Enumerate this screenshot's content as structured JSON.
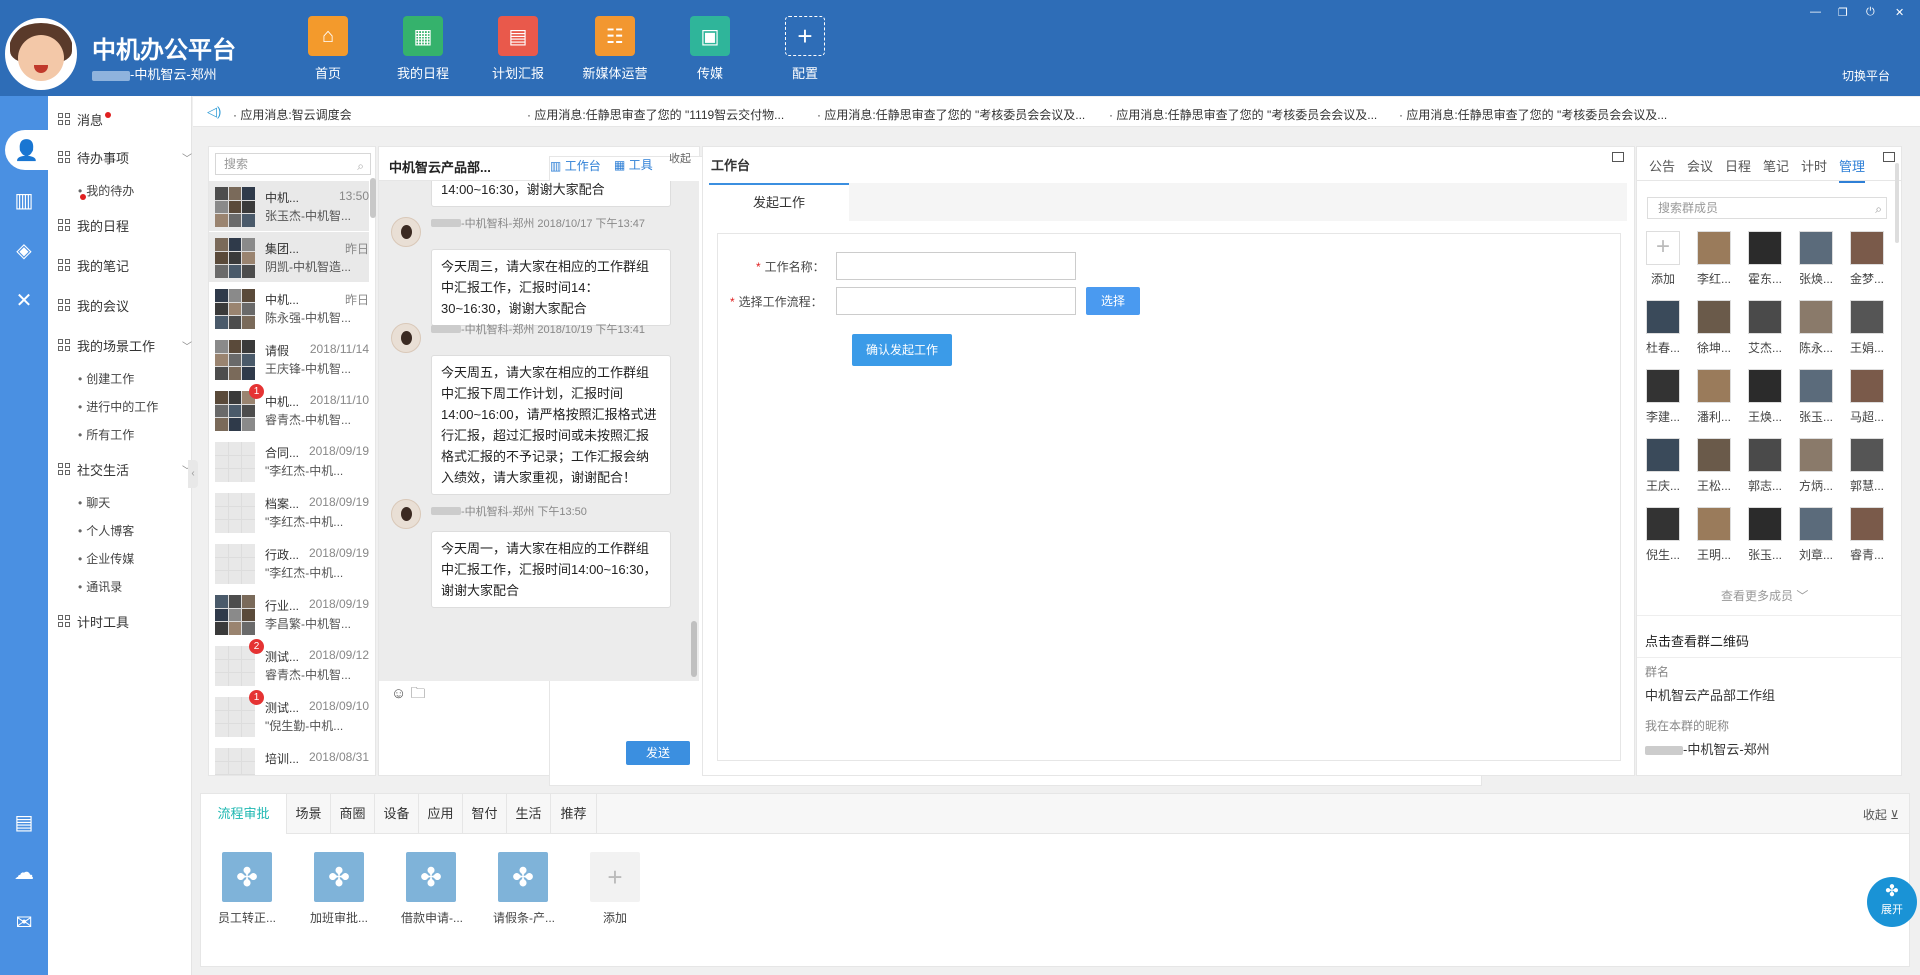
{
  "app": {
    "title": "中机办公平台",
    "subtitle": "-中机智云-郑州",
    "switch_label": "切换平台"
  },
  "nav": [
    {
      "label": "首页",
      "icon": "home-icon",
      "color": "#f39a2c"
    },
    {
      "label": "我的日程",
      "icon": "calendar-icon",
      "color": "#35b26c"
    },
    {
      "label": "计划汇报",
      "icon": "report-icon",
      "color": "#e9594b"
    },
    {
      "label": "新媒体运营",
      "icon": "media-icon",
      "color": "#f29730"
    },
    {
      "label": "传媒",
      "icon": "news-icon",
      "color": "#2fb59a"
    },
    {
      "label": "配置",
      "icon": "plus-icon",
      "color": "transparent"
    }
  ],
  "menu": {
    "messages": "消息",
    "todo": "待办事项",
    "my_todo": "我的待办",
    "schedule": "我的日程",
    "notes": "我的笔记",
    "meetings": "我的会议",
    "scene_work": "我的场景工作",
    "create_work": "创建工作",
    "in_progress": "进行中的工作",
    "all_work": "所有工作",
    "social": "社交生活",
    "chat": "聊天",
    "blog": "个人博客",
    "enterprise_media": "企业传媒",
    "contacts": "通讯录",
    "timer_tool": "计时工具"
  },
  "marquee": [
    "· 应用消息:智云调度会",
    "· 应用消息:任静思审查了您的 \"1119智云交付物...",
    "· 应用消息:任静思审查了您的 \"考核委员会会议及...",
    "· 应用消息:任静思审查了您的 \"考核委员会会议及...",
    "· 应用消息:任静思审查了您的 \"考核委员会会议及..."
  ],
  "chatlist": {
    "search_placeholder": "搜索",
    "items": [
      {
        "name": "中机...",
        "time": "13:50",
        "preview": "张玉杰-中机智...",
        "badge": ""
      },
      {
        "name": "集团...",
        "time": "昨日",
        "preview": "阴凯-中机智造...",
        "badge": ""
      },
      {
        "name": "中机...",
        "time": "昨日",
        "preview": "陈永强-中机智...",
        "badge": ""
      },
      {
        "name": "请假",
        "time": "2018/11/14",
        "preview": "王庆锋-中机智...",
        "badge": ""
      },
      {
        "name": "中机...",
        "time": "2018/11/10",
        "preview": "睿青杰-中机智...",
        "badge": "1"
      },
      {
        "name": "合同...",
        "time": "2018/09/19",
        "preview": "\"李红杰-中机...",
        "badge": ""
      },
      {
        "name": "档案...",
        "time": "2018/09/19",
        "preview": "\"李红杰-中机...",
        "badge": ""
      },
      {
        "name": "行政...",
        "time": "2018/09/19",
        "preview": "\"李红杰-中机...",
        "badge": ""
      },
      {
        "name": "行业...",
        "time": "2018/09/19",
        "preview": "李昌繁-中机智...",
        "badge": ""
      },
      {
        "name": "测试...",
        "time": "2018/09/12",
        "preview": "睿青杰-中机智...",
        "badge": "2"
      },
      {
        "name": "测试...",
        "time": "2018/09/10",
        "preview": "\"倪生勤-中机...",
        "badge": "1"
      },
      {
        "name": "培训...",
        "time": "2018/08/31",
        "preview": "",
        "badge": ""
      }
    ]
  },
  "chat": {
    "title": "中机智云产品部...",
    "workbench_label": "工作台",
    "tools_label": "工具",
    "collapse_label": "收起",
    "messages": [
      {
        "meta": "",
        "text": "14:00~16:30，谢谢大家配合"
      },
      {
        "meta": "-中机智科-郑州  2018/10/17 下午13:47",
        "text": "今天周三，请大家在相应的工作群组中汇报工作，汇报时间14：30~16:30，谢谢大家配合"
      },
      {
        "meta": "-中机智科-郑州  2018/10/19 下午13:41",
        "text": "今天周五，请大家在相应的工作群组中汇报下周工作计划，汇报时间14:00~16:00，请严格按照汇报格式进行汇报，超过汇报时间或未按照汇报格式汇报的不予记录；工作汇报会纳入绩效，请大家重视，谢谢配合！"
      },
      {
        "meta": "-中机智科-郑州  下午13:50",
        "text": "今天周一，请大家在相应的工作群组中汇报工作，汇报时间14:00~16:30，谢谢大家配合"
      }
    ],
    "send_label": "发送"
  },
  "workbench": {
    "title": "工作台",
    "tab": "发起工作",
    "work_name_label": "工作名称：",
    "flow_label": "选择工作流程：",
    "select_label": "选择",
    "confirm_label": "确认发起工作"
  },
  "right": {
    "tabs": [
      "公告",
      "会议",
      "日程",
      "笔记",
      "计时",
      "管理"
    ],
    "search_placeholder": "搜索群成员",
    "members": [
      "添加",
      "李红...",
      "霍东...",
      "张焕...",
      "金梦...",
      "杜春...",
      "徐坤...",
      "艾杰...",
      "陈永...",
      "王娟...",
      "李建...",
      "潘利...",
      "王焕...",
      "张玉...",
      "马超...",
      "王庆...",
      "王松...",
      "郭志...",
      "方炳...",
      "郭慧...",
      "倪生...",
      "王明...",
      "张玉...",
      "刘章...",
      "睿青..."
    ],
    "more_label": "查看更多成员",
    "qr_label": "点击查看群二维码",
    "group_name_label": "群名",
    "group_name": "中机智云产品部工作组",
    "nickname_label": "我在本群的昵称",
    "nickname": "-中机智云-郑州"
  },
  "bottom": {
    "tabs": [
      "流程审批",
      "场景",
      "商圈",
      "设备",
      "应用",
      "智付",
      "生活",
      "推荐"
    ],
    "collapse_label": "收起",
    "apps": [
      "员工转正...",
      "加班审批...",
      "借款申请-...",
      "请假条-产...",
      "添加"
    ],
    "expand_label": "展开"
  }
}
